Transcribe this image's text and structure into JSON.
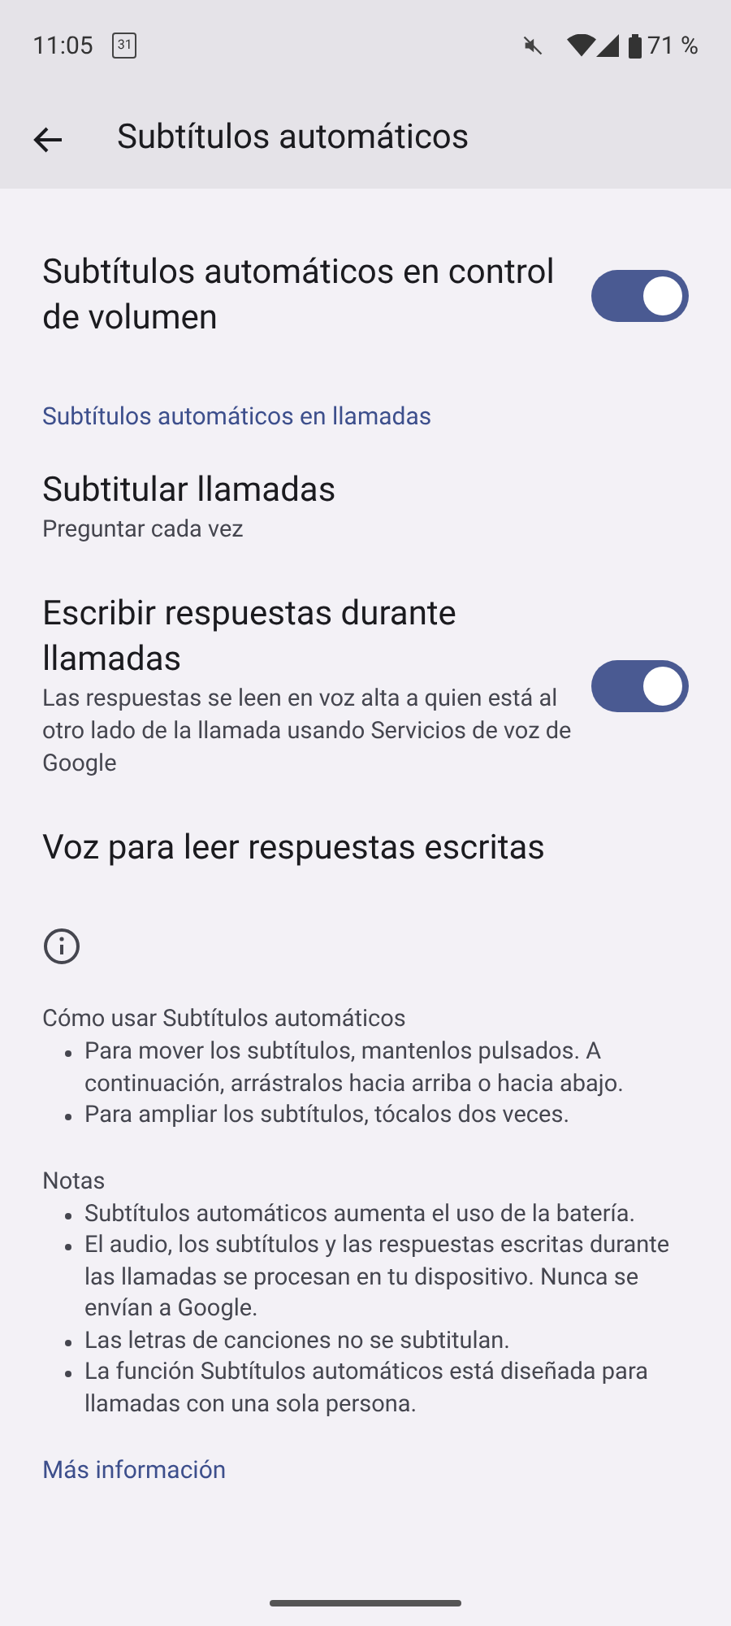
{
  "status_bar": {
    "time": "11:05",
    "calendar_day": "31",
    "battery": "71 %"
  },
  "app_bar": {
    "title": "Subtítulos automáticos"
  },
  "settings": [
    {
      "kind": "toggle",
      "title": "Subtítulos automáticos en control de volumen",
      "on": true
    },
    {
      "kind": "heading",
      "title": "Subtítulos automáticos en llamadas"
    },
    {
      "kind": "plain",
      "title": "Subtitular llamadas",
      "summary": "Preguntar cada vez"
    },
    {
      "kind": "toggle",
      "title": "Escribir respuestas durante llamadas",
      "summary": "Las respuestas se leen en voz alta a quien está al otro lado de la llamada usando Servicios de voz de Google",
      "on": true
    },
    {
      "kind": "plain",
      "title": "Voz para leer respuestas escritas"
    }
  ],
  "footer": {
    "sections": [
      {
        "title": "Cómo usar Subtítulos automáticos",
        "bullets": [
          "Para mover los subtítulos, mantenlos pulsados. A continuación, arrástralos hacia arriba o hacia abajo.",
          "Para ampliar los subtítulos, tócalos dos veces."
        ]
      },
      {
        "title": "Notas",
        "bullets": [
          "Subtítulos automáticos aumenta el uso de la batería.",
          "El audio, los subtítulos y las respuestas escritas durante las llamadas se procesan en tu dispositivo. Nunca se envían a Google.",
          "Las letras de canciones no se subtitulan.",
          "La función Subtítulos automáticos está diseñada para llamadas con una sola persona."
        ]
      }
    ],
    "link": "Más información"
  }
}
